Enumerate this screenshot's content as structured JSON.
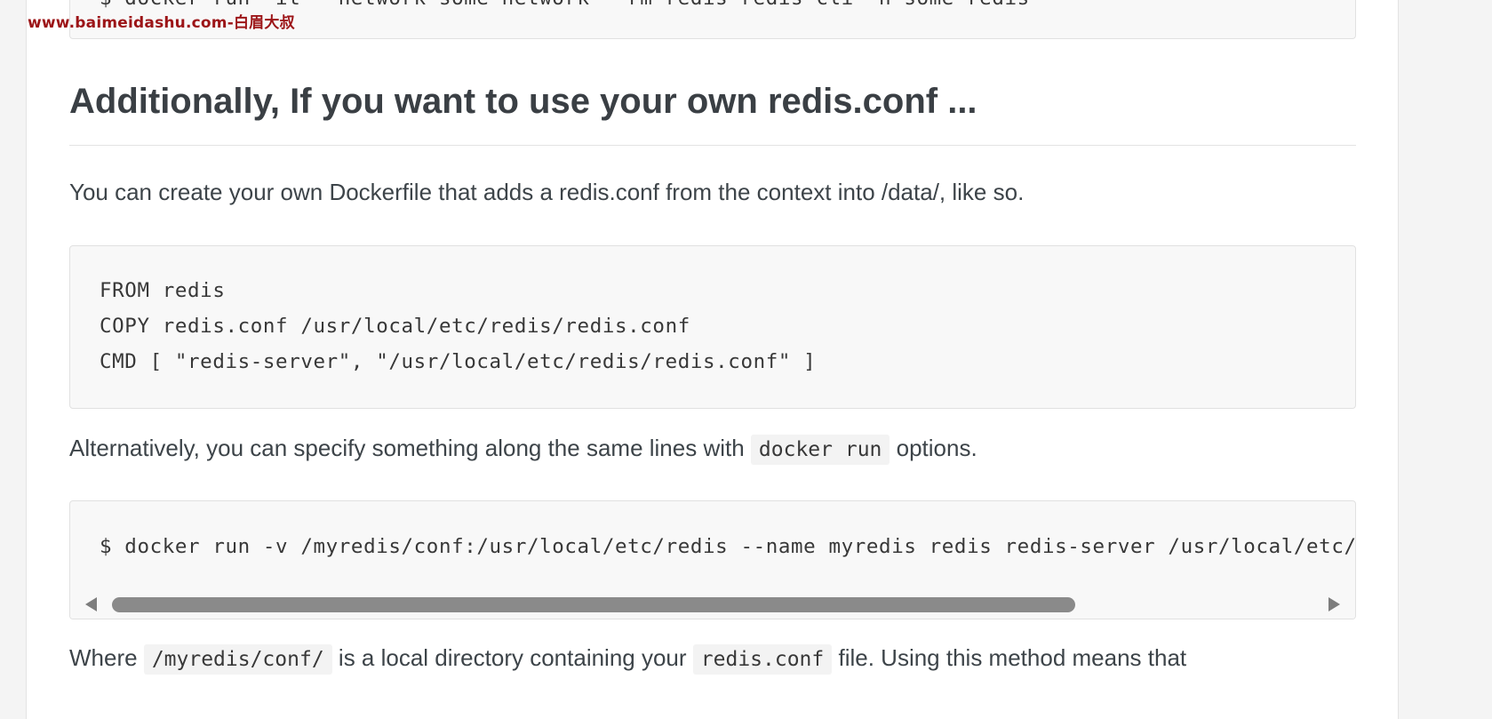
{
  "watermark": "www.baimeidashu.com-白眉大叔",
  "top_code_block": {
    "line": "$ docker run -it --network some-network --rm redis redis-cli -h some-redis"
  },
  "section": {
    "heading": "Additionally, If you want to use your own redis.conf ...",
    "intro": "You can create your own Dockerfile that adds a redis.conf from the context into /data/, like so.",
    "dockerfile_lines": [
      "FROM redis",
      "COPY redis.conf /usr/local/etc/redis/redis.conf",
      "CMD [ \"redis-server\", \"/usr/local/etc/redis/redis.conf\" ]"
    ],
    "alternative": {
      "before": "Alternatively, you can specify something along the same lines with ",
      "code": "docker run",
      "after": " options."
    },
    "run_command": "$ docker run -v /myredis/conf:/usr/local/etc/redis --name myredis redis redis-server /usr/local/etc/redis/redis.conf",
    "where": {
      "before": "Where ",
      "code1": "/myredis/conf/",
      "middle": " is a local directory containing your ",
      "code2": "redis.conf",
      "after": " file. Using this method means that"
    }
  },
  "scrollbar": {
    "left_arrow_icon": "triangle-left-icon",
    "right_arrow_icon": "triangle-right-icon"
  },
  "colors": {
    "watermark": "#9c1417",
    "text": "#3d4449",
    "code_bg": "#f8f8f8",
    "scroll_thumb": "#8a8a8a"
  }
}
